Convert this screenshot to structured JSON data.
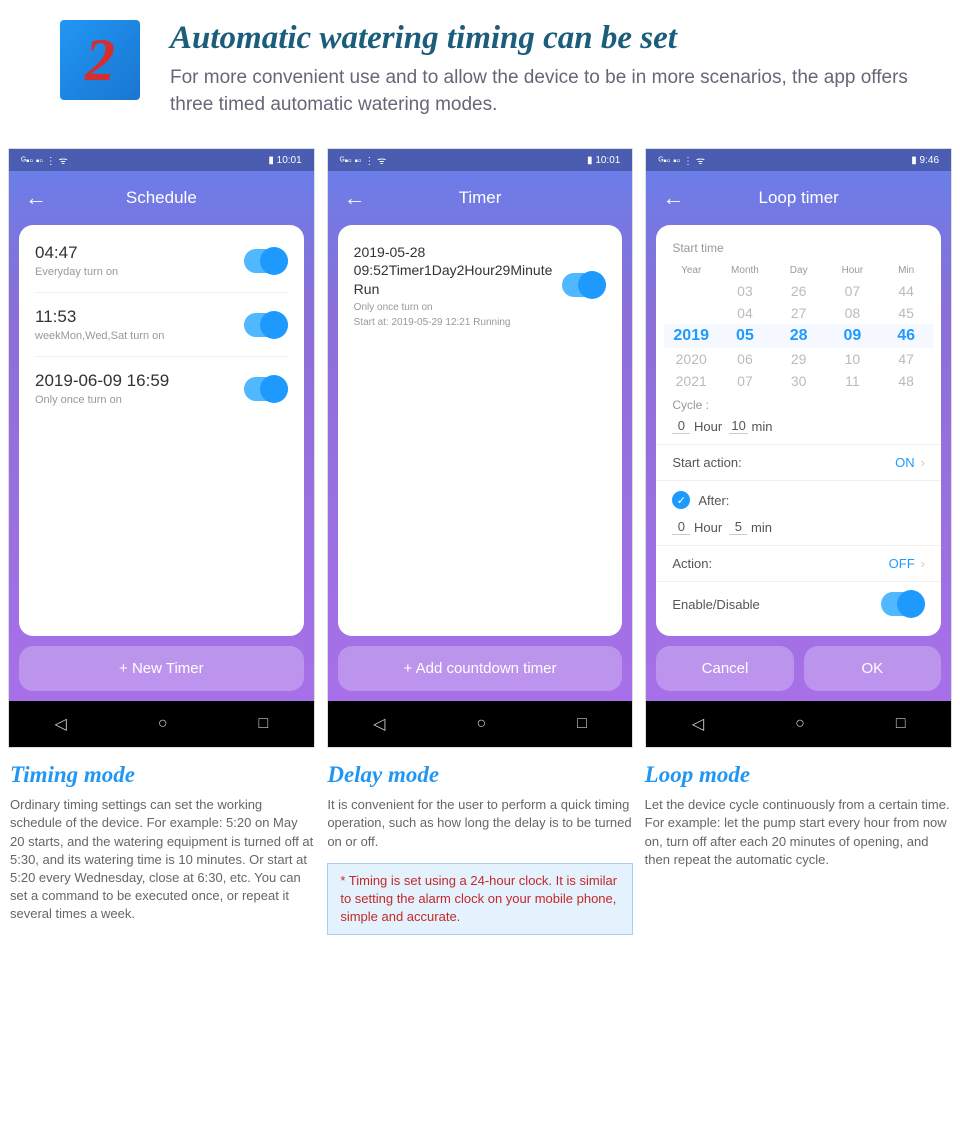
{
  "header": {
    "number": "2",
    "title": "Automatic watering timing can be set",
    "subtitle": "For more convenient use and to allow the device to be in more scenarios, the app offers three timed automatic watering modes."
  },
  "phone1": {
    "status_battery": "88",
    "status_time": "10:01",
    "title": "Schedule",
    "items": [
      {
        "time": "04:47",
        "sub": "Everyday turn on"
      },
      {
        "time": "11:53",
        "sub": "weekMon,Wed,Sat turn on"
      },
      {
        "time": "2019-06-09 16:59",
        "sub": "Only once turn on"
      }
    ],
    "button": "+  New Timer"
  },
  "phone2": {
    "status_battery": "88",
    "status_time": "10:01",
    "title": "Timer",
    "item_title": "2019-05-28 09:52Timer1Day2Hour29Minute Run",
    "item_sub1": "Only once turn on",
    "item_sub2": "Start at: 2019-05-29 12:21 Running",
    "button": "+  Add countdown timer"
  },
  "phone3": {
    "status_battery": "92",
    "status_time": "9:46",
    "title": "Loop timer",
    "start_label": "Start time",
    "picker_headers": [
      "Year",
      "Month",
      "Day",
      "Hour",
      "Min"
    ],
    "picker_rows": [
      [
        "",
        "03",
        "26",
        "07",
        "44"
      ],
      [
        "",
        "04",
        "27",
        "08",
        "45"
      ],
      [
        "2019",
        "05",
        "28",
        "09",
        "46"
      ],
      [
        "2020",
        "06",
        "29",
        "10",
        "47"
      ],
      [
        "2021",
        "07",
        "30",
        "11",
        "48"
      ]
    ],
    "cycle_label": "Cycle :",
    "cycle_h": "0",
    "cycle_h_u": "Hour",
    "cycle_m": "10",
    "cycle_m_u": "min",
    "start_action_label": "Start action:",
    "start_action_val": "ON",
    "after_label": "After:",
    "after_h": "0",
    "after_h_u": "Hour",
    "after_m": "5",
    "after_m_u": "min",
    "action_label": "Action:",
    "action_val": "OFF",
    "enable_label": "Enable/Disable",
    "cancel": "Cancel",
    "ok": "OK"
  },
  "mode1": {
    "title": "Timing mode",
    "body": "Ordinary timing settings can set the working schedule of the device.  For example: 5:20 on May 20 starts, and the watering equipment is turned off at 5:30, and its watering time is 10 minutes. Or start at 5:20 every Wednesday, close at 6:30, etc. You can set a command to be executed once, or repeat it several times a week."
  },
  "mode2": {
    "title": "Delay mode",
    "body": "It is convenient for the user to perform a quick timing operation, such as how long the delay is to be turned on or off."
  },
  "mode3": {
    "title": "Loop mode",
    "body": "Let the device cycle continuously from a certain time. For example: let the pump start every hour from now on, turn off after each 20 minutes of opening, and then repeat the automatic cycle."
  },
  "note": "* Timing is set using a 24-hour clock. It is similar to setting the alarm clock on your mobile phone, simple and accurate."
}
